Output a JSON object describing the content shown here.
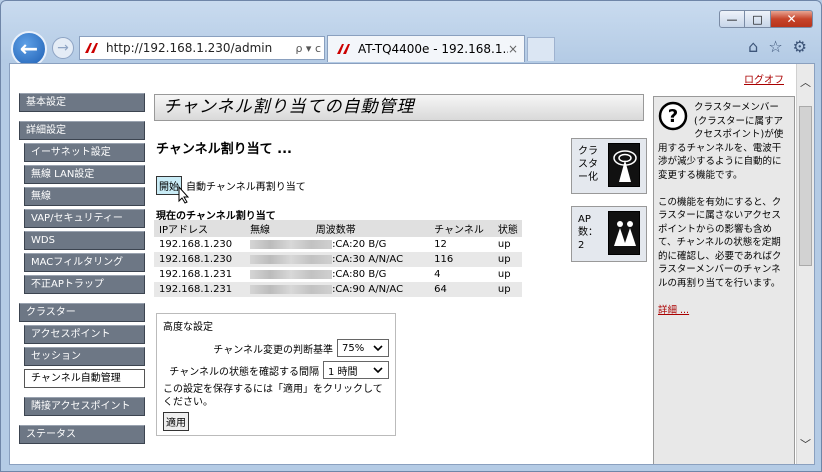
{
  "browser": {
    "url": "http://192.168.1.230/admin",
    "tab_title": "AT-TQ4400e - 192.168.1...",
    "tab_close": "×",
    "addr_controls": "ρ ▾ c",
    "back_icon": "←",
    "forward_icon": "→",
    "minimize_icon": "—",
    "maximize_icon": "□",
    "close_icon": "✕"
  },
  "header": {
    "logout": "ログオフ"
  },
  "sidebar": {
    "items": [
      {
        "label": "基本設定"
      },
      {
        "label": "詳細設定"
      },
      {
        "label": "イーサネット設定"
      },
      {
        "label": "無線 LAN設定"
      },
      {
        "label": "無線"
      },
      {
        "label": "VAP/セキュリティー"
      },
      {
        "label": "WDS"
      },
      {
        "label": "MACフィルタリング"
      },
      {
        "label": "不正APトラップ"
      },
      {
        "label": "クラスター"
      },
      {
        "label": "アクセスポイント"
      },
      {
        "label": "セッション"
      },
      {
        "label": "チャンネル自動管理"
      },
      {
        "label": "隣接アクセスポイント"
      },
      {
        "label": "ステータス"
      }
    ]
  },
  "main": {
    "title": "チャンネル割り当ての自動管理",
    "subtitle": "チャンネル割り当て ...",
    "start_button": "開始",
    "start_label": "自動チャンネル再割り当て",
    "current_heading": "現在のチャンネル割り当て",
    "table": {
      "headers": [
        "IPアドレス",
        "無線",
        "周波数帯",
        "チャンネル",
        "状態"
      ],
      "rows": [
        {
          "ip": "192.168.1.230",
          "radio_suffix": ":CA:20",
          "band": "B/G",
          "channel": "12",
          "status": "up"
        },
        {
          "ip": "192.168.1.230",
          "radio_suffix": ":CA:30",
          "band": "A/N/AC",
          "channel": "116",
          "status": "up"
        },
        {
          "ip": "192.168.1.231",
          "radio_suffix": ":CA:80",
          "band": "B/G",
          "channel": "4",
          "status": "up"
        },
        {
          "ip": "192.168.1.231",
          "radio_suffix": ":CA:90",
          "band": "A/N/AC",
          "channel": "64",
          "status": "up"
        }
      ]
    },
    "advanced": {
      "label": "高度な設定",
      "threshold_label": "チャンネル変更の判断基準",
      "threshold_value": "75%",
      "interval_label": "チャンネルの状態を確認する間隔",
      "interval_value": "1 時間",
      "note": "この設定を保存するには「適用」をクリックしてください。",
      "apply_button": "適用"
    }
  },
  "cards": {
    "cluster_label": "クラスター化",
    "ap_label": "AP 数：",
    "ap_count": "2"
  },
  "help": {
    "text1": "クラスターメンバー(クラスターに属すアクセスポイント)が使用するチャンネルを、電波干渉が減少するように自動的に変更する機能です。",
    "text2": "この機能を有効にすると、クラスターに属さないアクセスポイントからの影響も含めて、チャンネルの状態を定期的に確認し、必要であればクラスターメンバーのチャンネルの再割り当てを行います。",
    "more_link": "詳細 ..."
  },
  "colors": {
    "nav_bg": "#6d7785",
    "accent_link": "#aa0000",
    "start_btn": "#c9ecf6"
  }
}
